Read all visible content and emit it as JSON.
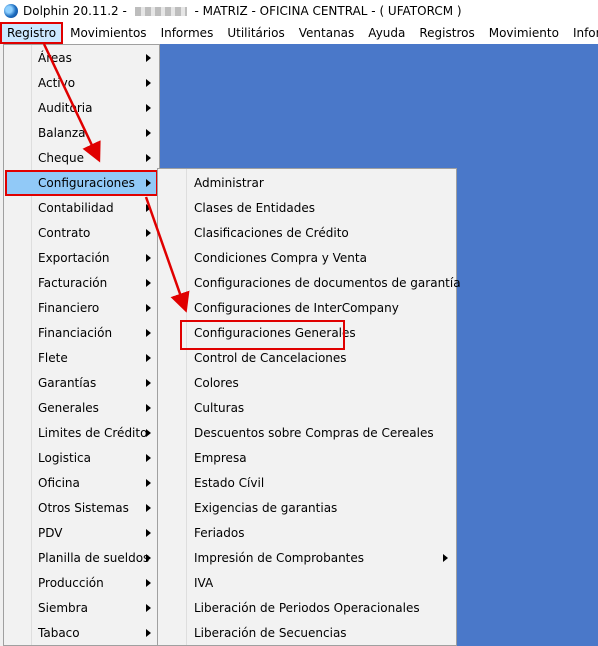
{
  "window": {
    "title_prefix": "Dolphin 20.11.2 -",
    "title_suffix": "- MATRIZ - OFICINA CENTRAL -  ( UFATORCM )"
  },
  "menubar": [
    "Registro",
    "Movimientos",
    "Informes",
    "Utilitários",
    "Ventanas",
    "Ayuda",
    "Registros",
    "Movimiento",
    "Informes"
  ],
  "registro_menu": [
    {
      "label": "Áreas"
    },
    {
      "label": "Activo"
    },
    {
      "label": "Auditoria"
    },
    {
      "label": "Balanza"
    },
    {
      "label": "Cheque"
    },
    {
      "label": "Configuraciones"
    },
    {
      "label": "Contabilidad"
    },
    {
      "label": "Contrato"
    },
    {
      "label": "Exportación"
    },
    {
      "label": "Facturación"
    },
    {
      "label": "Financiero"
    },
    {
      "label": "Financiación"
    },
    {
      "label": "Flete"
    },
    {
      "label": "Garantías"
    },
    {
      "label": "Generales"
    },
    {
      "label": "Limites de Crédito"
    },
    {
      "label": "Logistica"
    },
    {
      "label": "Oficina"
    },
    {
      "label": "Otros Sistemas"
    },
    {
      "label": "PDV"
    },
    {
      "label": "Planilla de sueldos"
    },
    {
      "label": "Producción"
    },
    {
      "label": "Siembra"
    },
    {
      "label": "Tabaco"
    }
  ],
  "configuraciones_menu": [
    {
      "label": "Administrar",
      "submenu": false
    },
    {
      "label": "Clases de Entidades",
      "submenu": false
    },
    {
      "label": "Clasificaciones de Crédito",
      "submenu": false
    },
    {
      "label": "Condiciones Compra y Venta",
      "submenu": false
    },
    {
      "label": "Configuraciones de documentos de garantía",
      "submenu": false
    },
    {
      "label": "Configuraciones de InterCompany",
      "submenu": false
    },
    {
      "label": "Configuraciones Generales",
      "submenu": false
    },
    {
      "label": "Control de Cancelaciones",
      "submenu": false
    },
    {
      "label": "Colores",
      "submenu": false
    },
    {
      "label": "Culturas",
      "submenu": false
    },
    {
      "label": "Descuentos sobre Compras de Cereales",
      "submenu": false
    },
    {
      "label": "Empresa",
      "submenu": false
    },
    {
      "label": "Estado Cívil",
      "submenu": false
    },
    {
      "label": "Exigencias de garantias",
      "submenu": false
    },
    {
      "label": "Feriados",
      "submenu": false
    },
    {
      "label": "Impresión de Comprobantes",
      "submenu": true
    },
    {
      "label": "IVA",
      "submenu": false
    },
    {
      "label": "Liberación de Periodos Operacionales",
      "submenu": false
    },
    {
      "label": "Liberación de Secuencias",
      "submenu": false
    }
  ],
  "colors": {
    "annotation": "#e00000",
    "desktop": "#4a78c9",
    "highlight": "#91c9f7"
  }
}
